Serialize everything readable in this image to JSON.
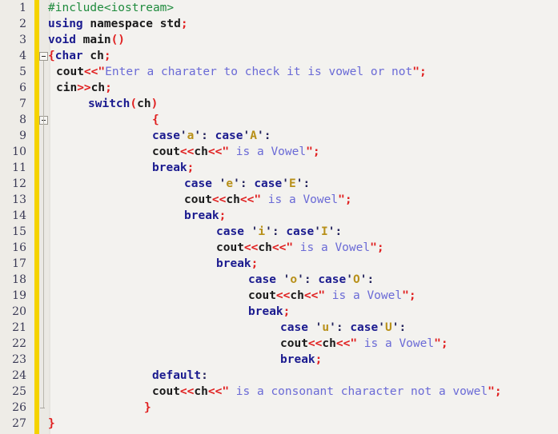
{
  "editor": {
    "language": "cpp",
    "total_lines": 27,
    "colors": {
      "background": "#f3f2ef",
      "gutter_background": "#eeece7",
      "gutter_accent_bar": "#f5d300",
      "fold_margin": "#ebe9e4",
      "line_number": "#3a3a55",
      "preprocessor": "#1f8b3d",
      "keyword": "#1b1b8f",
      "identifier": "#1a1a1a",
      "punctuation": "#e02020",
      "string": "#6a6ad6",
      "char_literal": "#b89019"
    },
    "fold_markers": [
      {
        "line": 4,
        "type": "collapse-box"
      },
      {
        "line": 8,
        "type": "collapse-box"
      },
      {
        "line": 26,
        "type": "fold-end-tick"
      }
    ]
  },
  "lines": [
    {
      "number": "1",
      "indent": 0,
      "tokens": [
        {
          "t": "pre",
          "v": "#include<iostream>"
        }
      ]
    },
    {
      "number": "2",
      "indent": 0,
      "tokens": [
        {
          "t": "kw",
          "v": "using"
        },
        {
          "t": "id",
          "v": " namespace"
        },
        {
          "t": "id",
          "v": " std"
        },
        {
          "t": "punc",
          "v": ";"
        }
      ]
    },
    {
      "number": "3",
      "indent": 0,
      "tokens": [
        {
          "t": "kw",
          "v": "void"
        },
        {
          "t": "id",
          "v": " main"
        },
        {
          "t": "punc",
          "v": "()"
        }
      ]
    },
    {
      "number": "4",
      "indent": 0,
      "tokens": [
        {
          "t": "punc",
          "v": "{"
        },
        {
          "t": "kw",
          "v": "char"
        },
        {
          "t": "id",
          "v": " ch"
        },
        {
          "t": "punc",
          "v": ";"
        }
      ]
    },
    {
      "number": "5",
      "indent": 1,
      "tokens": [
        {
          "t": "id",
          "v": "cout"
        },
        {
          "t": "punc",
          "v": "<<"
        },
        {
          "t": "strq",
          "v": "\""
        },
        {
          "t": "str",
          "v": "Enter a charater to check it is vowel or not"
        },
        {
          "t": "strq",
          "v": "\""
        },
        {
          "t": "punc",
          "v": ";"
        }
      ]
    },
    {
      "number": "6",
      "indent": 1,
      "tokens": [
        {
          "t": "id",
          "v": "cin"
        },
        {
          "t": "punc",
          "v": ">>"
        },
        {
          "t": "id",
          "v": "ch"
        },
        {
          "t": "punc",
          "v": ";"
        }
      ]
    },
    {
      "number": "7",
      "indent": 5,
      "tokens": [
        {
          "t": "kw",
          "v": "switch"
        },
        {
          "t": "punc",
          "v": "("
        },
        {
          "t": "id",
          "v": "ch"
        },
        {
          "t": "punc",
          "v": ")"
        }
      ]
    },
    {
      "number": "8",
      "indent": 13,
      "tokens": [
        {
          "t": "punc",
          "v": "{"
        }
      ]
    },
    {
      "number": "9",
      "indent": 13,
      "tokens": [
        {
          "t": "kw",
          "v": "case"
        },
        {
          "t": "chrq",
          "v": "'"
        },
        {
          "t": "chr",
          "v": "a"
        },
        {
          "t": "chrq",
          "v": "'"
        },
        {
          "t": "col",
          "v": ": "
        },
        {
          "t": "kw",
          "v": "case"
        },
        {
          "t": "chrq",
          "v": "'"
        },
        {
          "t": "chr",
          "v": "A"
        },
        {
          "t": "chrq",
          "v": "'"
        },
        {
          "t": "col",
          "v": ":"
        }
      ]
    },
    {
      "number": "10",
      "indent": 13,
      "tokens": [
        {
          "t": "id",
          "v": "cout"
        },
        {
          "t": "punc",
          "v": "<<"
        },
        {
          "t": "id",
          "v": "ch"
        },
        {
          "t": "punc",
          "v": "<<"
        },
        {
          "t": "strq",
          "v": "\""
        },
        {
          "t": "str",
          "v": " is a Vowel"
        },
        {
          "t": "strq",
          "v": "\""
        },
        {
          "t": "punc",
          "v": ";"
        }
      ]
    },
    {
      "number": "11",
      "indent": 13,
      "tokens": [
        {
          "t": "kw",
          "v": "break"
        },
        {
          "t": "punc",
          "v": ";"
        }
      ]
    },
    {
      "number": "12",
      "indent": 17,
      "tokens": [
        {
          "t": "kw",
          "v": "case"
        },
        {
          "t": "id",
          "v": " "
        },
        {
          "t": "chrq",
          "v": "'"
        },
        {
          "t": "chr",
          "v": "e"
        },
        {
          "t": "chrq",
          "v": "'"
        },
        {
          "t": "col",
          "v": ": "
        },
        {
          "t": "kw",
          "v": "case"
        },
        {
          "t": "chrq",
          "v": "'"
        },
        {
          "t": "chr",
          "v": "E"
        },
        {
          "t": "chrq",
          "v": "'"
        },
        {
          "t": "col",
          "v": ":"
        }
      ]
    },
    {
      "number": "13",
      "indent": 17,
      "tokens": [
        {
          "t": "id",
          "v": "cout"
        },
        {
          "t": "punc",
          "v": "<<"
        },
        {
          "t": "id",
          "v": "ch"
        },
        {
          "t": "punc",
          "v": "<<"
        },
        {
          "t": "strq",
          "v": "\""
        },
        {
          "t": "str",
          "v": " is a Vowel"
        },
        {
          "t": "strq",
          "v": "\""
        },
        {
          "t": "punc",
          "v": ";"
        }
      ]
    },
    {
      "number": "14",
      "indent": 17,
      "tokens": [
        {
          "t": "kw",
          "v": "break"
        },
        {
          "t": "punc",
          "v": ";"
        }
      ]
    },
    {
      "number": "15",
      "indent": 21,
      "tokens": [
        {
          "t": "kw",
          "v": "case"
        },
        {
          "t": "id",
          "v": " "
        },
        {
          "t": "chrq",
          "v": "'"
        },
        {
          "t": "chr",
          "v": "i"
        },
        {
          "t": "chrq",
          "v": "'"
        },
        {
          "t": "col",
          "v": ": "
        },
        {
          "t": "kw",
          "v": "case"
        },
        {
          "t": "chrq",
          "v": "'"
        },
        {
          "t": "chr",
          "v": "I"
        },
        {
          "t": "chrq",
          "v": "'"
        },
        {
          "t": "col",
          "v": ":"
        }
      ]
    },
    {
      "number": "16",
      "indent": 21,
      "tokens": [
        {
          "t": "id",
          "v": "cout"
        },
        {
          "t": "punc",
          "v": "<<"
        },
        {
          "t": "id",
          "v": "ch"
        },
        {
          "t": "punc",
          "v": "<<"
        },
        {
          "t": "strq",
          "v": "\""
        },
        {
          "t": "str",
          "v": " is a Vowel"
        },
        {
          "t": "strq",
          "v": "\""
        },
        {
          "t": "punc",
          "v": ";"
        }
      ]
    },
    {
      "number": "17",
      "indent": 21,
      "tokens": [
        {
          "t": "kw",
          "v": "break"
        },
        {
          "t": "punc",
          "v": ";"
        }
      ]
    },
    {
      "number": "18",
      "indent": 25,
      "tokens": [
        {
          "t": "kw",
          "v": "case"
        },
        {
          "t": "id",
          "v": " "
        },
        {
          "t": "chrq",
          "v": "'"
        },
        {
          "t": "chr",
          "v": "o"
        },
        {
          "t": "chrq",
          "v": "'"
        },
        {
          "t": "col",
          "v": ": "
        },
        {
          "t": "kw",
          "v": "case"
        },
        {
          "t": "chrq",
          "v": "'"
        },
        {
          "t": "chr",
          "v": "O"
        },
        {
          "t": "chrq",
          "v": "'"
        },
        {
          "t": "col",
          "v": ":"
        }
      ]
    },
    {
      "number": "19",
      "indent": 25,
      "tokens": [
        {
          "t": "id",
          "v": "cout"
        },
        {
          "t": "punc",
          "v": "<<"
        },
        {
          "t": "id",
          "v": "ch"
        },
        {
          "t": "punc",
          "v": "<<"
        },
        {
          "t": "strq",
          "v": "\""
        },
        {
          "t": "str",
          "v": " is a Vowel"
        },
        {
          "t": "strq",
          "v": "\""
        },
        {
          "t": "punc",
          "v": ";"
        }
      ]
    },
    {
      "number": "20",
      "indent": 25,
      "tokens": [
        {
          "t": "kw",
          "v": "break"
        },
        {
          "t": "punc",
          "v": ";"
        }
      ]
    },
    {
      "number": "21",
      "indent": 29,
      "tokens": [
        {
          "t": "kw",
          "v": "case"
        },
        {
          "t": "id",
          "v": " "
        },
        {
          "t": "chrq",
          "v": "'"
        },
        {
          "t": "chr",
          "v": "u"
        },
        {
          "t": "chrq",
          "v": "'"
        },
        {
          "t": "col",
          "v": ": "
        },
        {
          "t": "kw",
          "v": "case"
        },
        {
          "t": "chrq",
          "v": "'"
        },
        {
          "t": "chr",
          "v": "U"
        },
        {
          "t": "chrq",
          "v": "'"
        },
        {
          "t": "col",
          "v": ":"
        }
      ]
    },
    {
      "number": "22",
      "indent": 29,
      "tokens": [
        {
          "t": "id",
          "v": "cout"
        },
        {
          "t": "punc",
          "v": "<<"
        },
        {
          "t": "id",
          "v": "ch"
        },
        {
          "t": "punc",
          "v": "<<"
        },
        {
          "t": "strq",
          "v": "\""
        },
        {
          "t": "str",
          "v": " is a Vowel"
        },
        {
          "t": "strq",
          "v": "\""
        },
        {
          "t": "punc",
          "v": ";"
        }
      ]
    },
    {
      "number": "23",
      "indent": 29,
      "tokens": [
        {
          "t": "kw",
          "v": "break"
        },
        {
          "t": "punc",
          "v": ";"
        }
      ]
    },
    {
      "number": "24",
      "indent": 13,
      "tokens": [
        {
          "t": "kw",
          "v": "default"
        },
        {
          "t": "col",
          "v": ":"
        }
      ]
    },
    {
      "number": "25",
      "indent": 13,
      "tokens": [
        {
          "t": "id",
          "v": "cout"
        },
        {
          "t": "punc",
          "v": "<<"
        },
        {
          "t": "id",
          "v": "ch"
        },
        {
          "t": "punc",
          "v": "<<"
        },
        {
          "t": "strq",
          "v": "\""
        },
        {
          "t": "str",
          "v": " is a consonant character not a vowel"
        },
        {
          "t": "strq",
          "v": "\""
        },
        {
          "t": "punc",
          "v": ";"
        }
      ]
    },
    {
      "number": "26",
      "indent": 12,
      "tokens": [
        {
          "t": "punc",
          "v": "}"
        }
      ]
    },
    {
      "number": "27",
      "indent": 0,
      "tokens": [
        {
          "t": "punc",
          "v": "}"
        }
      ]
    }
  ]
}
